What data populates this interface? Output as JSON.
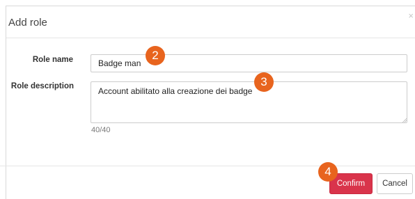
{
  "dialog": {
    "title": "Add role",
    "close_glyph": "×",
    "close_icon": "close-icon"
  },
  "form": {
    "role_name_label": "Role name",
    "role_name_value": "Badge man",
    "role_description_label": "Role description",
    "role_description_value": "Account abilitato alla creazione dei badge",
    "char_counter": "40/40"
  },
  "footer": {
    "confirm_label": "Confirm",
    "cancel_label": "Cancel"
  },
  "callouts": [
    "2",
    "3",
    "4"
  ],
  "colors": {
    "confirm_button": "#d9344b",
    "callout_badge": "#e8641e"
  }
}
